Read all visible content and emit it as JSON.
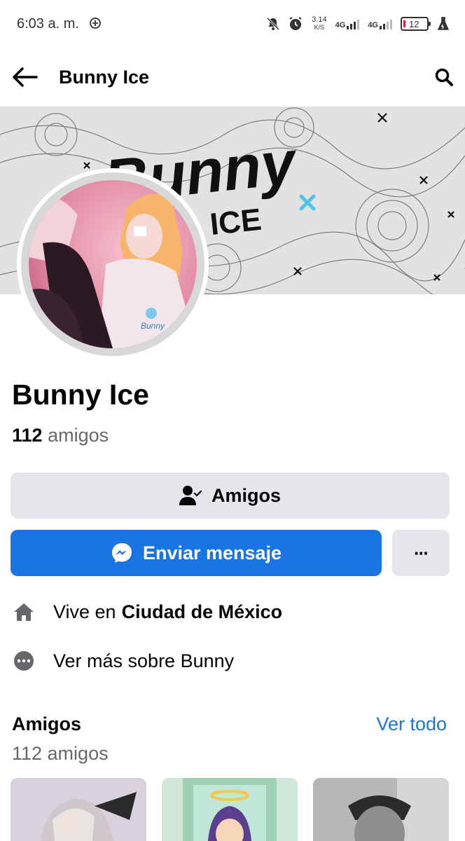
{
  "status_bar": {
    "time": "6:03 a. m.",
    "speed_value": "3.14",
    "speed_unit": "K/S",
    "network_1": "4G",
    "network_2": "4G",
    "battery": "12"
  },
  "header": {
    "title": "Bunny Ice",
    "icons": {
      "back": "back-arrow-icon",
      "search": "search-icon"
    }
  },
  "cover": {
    "logo_text": "Bunny",
    "logo_sub": "ICE"
  },
  "avatar": {
    "watermark": "Bunny"
  },
  "profile": {
    "name": "Bunny Ice",
    "friends_number": "112",
    "friends_word": "amigos"
  },
  "actions": {
    "friends_label": "Amigos",
    "message_label": "Enviar mensaje",
    "more_label": "···"
  },
  "info": {
    "lives_prefix": "Vive en",
    "lives_city": "Ciudad de México",
    "see_more": "Ver más sobre Bunny"
  },
  "friends_section": {
    "title": "Amigos",
    "see_all": "Ver todo",
    "count": "112 amigos"
  },
  "colors": {
    "accent": "#1b74e4",
    "button_gray": "#e4e6eb",
    "secondary_text": "#65676b"
  }
}
